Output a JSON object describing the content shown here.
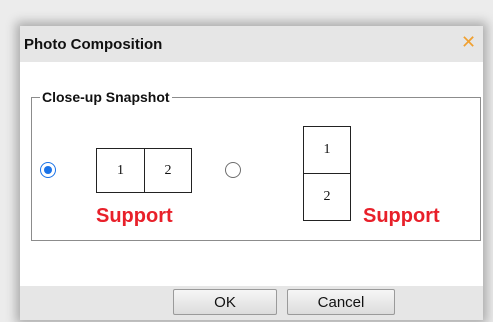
{
  "dialog": {
    "title": "Photo Composition",
    "close_glyph": "✕",
    "close_icon": "close-icon",
    "accent_color": "#1a73e8",
    "close_color": "#f0a030"
  },
  "snapshot": {
    "legend": "Close-up Snapshot",
    "options": [
      {
        "selected": true,
        "layout": "horizontal",
        "cells": [
          "1",
          "2"
        ],
        "label": "Support"
      },
      {
        "selected": false,
        "layout": "vertical",
        "cells": [
          "1",
          "2"
        ],
        "label": "Support"
      }
    ],
    "label_color": "#e8202a"
  },
  "buttons": {
    "ok": "OK",
    "cancel": "Cancel"
  }
}
